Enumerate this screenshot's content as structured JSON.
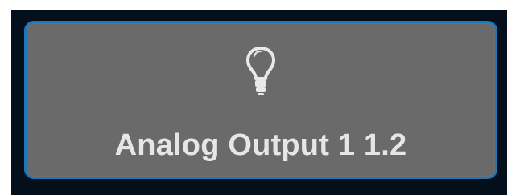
{
  "tile": {
    "label": "Analog Output 1 1.2",
    "icon": "lightbulb-icon",
    "background_color": "#6a6a6a",
    "border_color": "#1f77b7",
    "text_color": "#e6e6e6"
  },
  "page": {
    "background_color": "#03101c"
  }
}
